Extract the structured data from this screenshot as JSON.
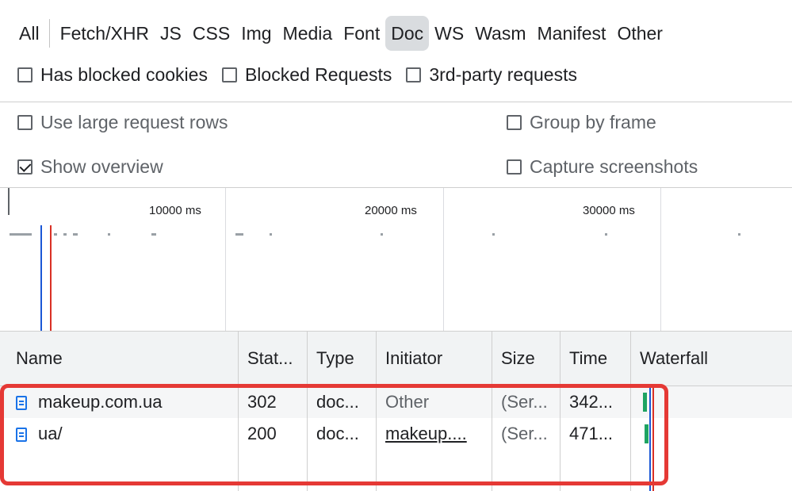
{
  "filters": {
    "types": [
      "All",
      "Fetch/XHR",
      "JS",
      "CSS",
      "Img",
      "Media",
      "Font",
      "Doc",
      "WS",
      "Wasm",
      "Manifest",
      "Other"
    ],
    "active_type": "Doc",
    "checkboxes": [
      {
        "label": "Has blocked cookies",
        "checked": false
      },
      {
        "label": "Blocked Requests",
        "checked": false
      },
      {
        "label": "3rd-party requests",
        "checked": false
      }
    ]
  },
  "settings": {
    "large_rows": "Use large request rows",
    "group_by_frame": "Group by frame",
    "show_overview": "Show overview",
    "capture_screenshots": "Capture screenshots"
  },
  "overview": {
    "ticks": [
      "10000 ms",
      "20000 ms",
      "30000 ms"
    ]
  },
  "table": {
    "headers": [
      "Name",
      "Stat...",
      "Type",
      "Initiator",
      "Size",
      "Time",
      "Waterfall"
    ],
    "rows": [
      {
        "name": "makeup.com.ua",
        "status": "302",
        "type": "doc...",
        "initiator": "Other",
        "size": "(Ser...",
        "time": "342..."
      },
      {
        "name": "ua/",
        "status": "200",
        "type": "doc...",
        "initiator": "makeup....",
        "size": "(Ser...",
        "time": "471..."
      }
    ]
  },
  "colors": {
    "highlight": "#e53935",
    "doc_icon": "#1a73e8",
    "waterfall_bar": "#1ea362",
    "dom_content_line": "#1a57d6",
    "load_line": "#d93025"
  }
}
